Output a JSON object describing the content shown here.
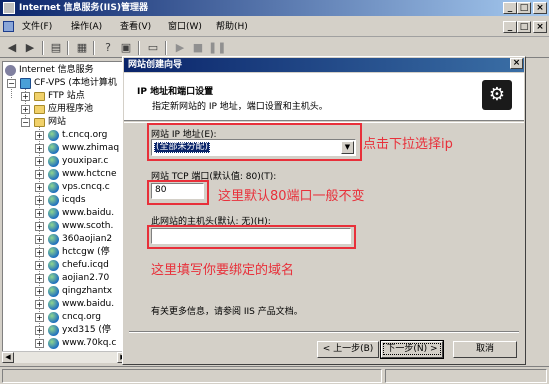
{
  "window": {
    "title": "Internet 信息服务(IIS)管理器",
    "controls": [
      "_",
      "□",
      "×"
    ]
  },
  "menubar": {
    "items": [
      "文件(F)",
      "操作(A)",
      "查看(V)",
      "窗口(W)",
      "帮助(H)"
    ],
    "mdi_controls": [
      "_",
      "□",
      "×"
    ]
  },
  "toolbar": {
    "buttons": [
      "back-arrow",
      "forward-arrow",
      "up-folder",
      "refresh",
      "help",
      "properties",
      "computer",
      "play",
      "stop",
      "pause"
    ]
  },
  "tree": {
    "root": "Internet 信息服务",
    "server": "CF-VPS (本地计算机",
    "ftp": "FTP 站点",
    "apppool": "应用程序池",
    "websites": "网站",
    "sites": [
      "t.cncq.org",
      "www.zhimaq",
      "youxipar.c",
      "www.hctcne",
      "vps.cncq.c",
      "icqds",
      "www.baidu.",
      "www.scoth.",
      "360aojian2",
      "hctcgw (停",
      "chefu.icqd",
      "aojian2.70",
      "qingzhantx",
      "www.baidu.",
      "cncq.org",
      "yxd315 (停",
      "www.70kq.c"
    ]
  },
  "dialog": {
    "title": "网站创建向导",
    "close": "×",
    "header_title": "IP 地址和端口设置",
    "header_subtitle": "指定新网站的 IP 地址，端口设置和主机头。",
    "ip_label": "网站 IP 地址(E):",
    "ip_value": "(全部未分配)",
    "port_label": "网站 TCP 端口(默认值: 80)(T):",
    "port_value": "80",
    "host_label": "此网站的主机头(默认: 无)(H):",
    "host_value": "",
    "more_info": "有关更多信息，请参阅 IIS 产品文档。",
    "buttons": {
      "back": "< 上一步(B)",
      "next": "下一步(N) >",
      "cancel": "取消"
    }
  },
  "annotations": {
    "ip_note": "点击下拉选择ip",
    "port_note": "这里默认80端口一般不变",
    "host_note": "这里填写你要绑定的域名"
  },
  "colors": {
    "annotation_red": "#e8303a",
    "titlebar_blue": "#0a246a"
  }
}
